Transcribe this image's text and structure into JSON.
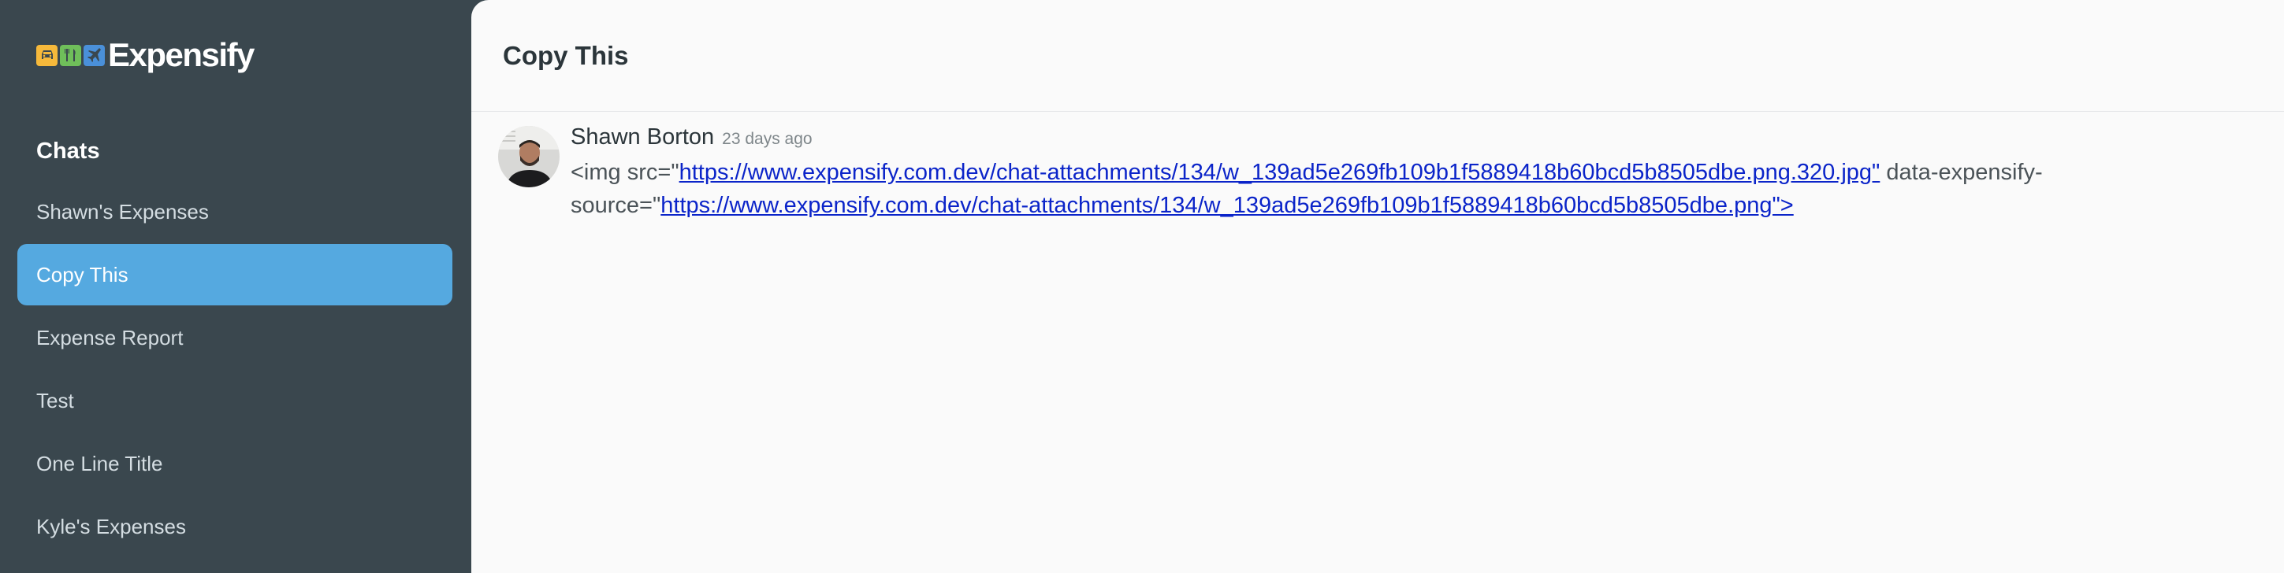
{
  "brand": {
    "name": "Expensify",
    "icon_colors": [
      "#f6b93b",
      "#6fbf5a",
      "#4a90d9"
    ]
  },
  "sidebar": {
    "heading": "Chats",
    "items": [
      {
        "label": "Shawn's Expenses",
        "active": false
      },
      {
        "label": "Copy This",
        "active": true
      },
      {
        "label": "Expense Report",
        "active": false
      },
      {
        "label": "Test",
        "active": false
      },
      {
        "label": "One Line Title",
        "active": false
      },
      {
        "label": "Kyle's Expenses",
        "active": false
      }
    ]
  },
  "chat": {
    "title": "Copy This",
    "message": {
      "author": "Shawn Borton",
      "timestamp": "23 days ago",
      "text_prefix": "<img src=\"",
      "link_1": "https://www.expensify.com.dev/chat-attachments/134/w_139ad5e269fb109b1f5889418b60bcd5b8505dbe.png.320.jpg\"",
      "text_middle": " data-expensify-source=\"",
      "link_2": "https://www.expensify.com.dev/chat-attachments/134/w_139ad5e269fb109b1f5889418b60bcd5b8505dbe.png\">"
    }
  },
  "colors": {
    "sidebar_bg": "#3a474e",
    "active_item": "#55a9e0",
    "link": "#0b24c9",
    "main_bg": "#fafafa"
  }
}
